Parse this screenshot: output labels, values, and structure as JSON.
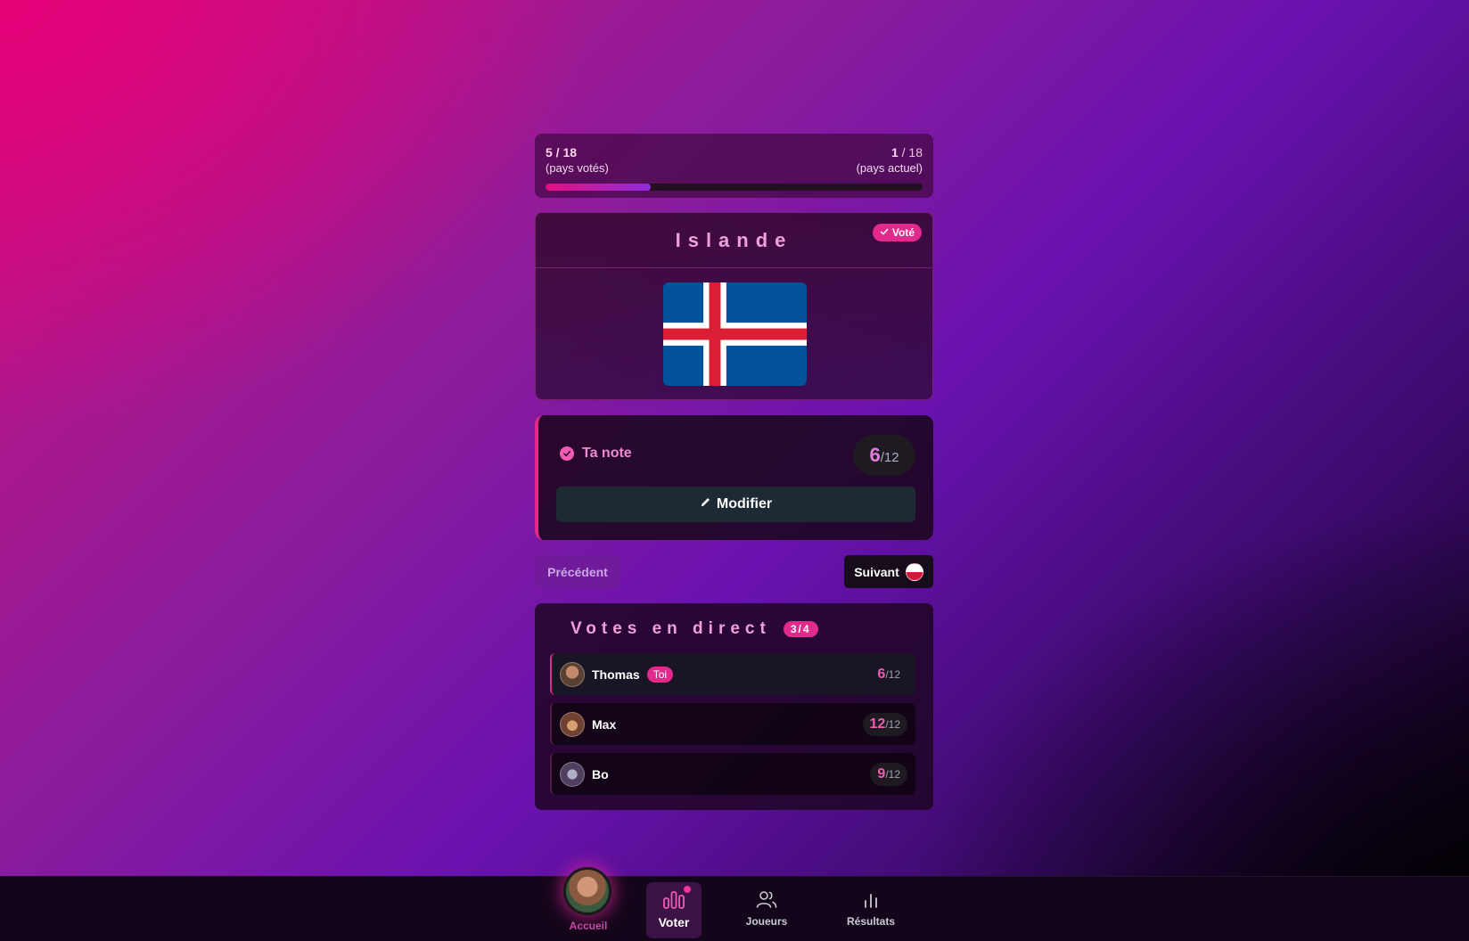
{
  "progress": {
    "voted_count": "5",
    "voted_total": " / 18",
    "voted_label": "(pays votés)",
    "current_count": "1",
    "current_total": " / 18",
    "current_label": "(pays actuel)",
    "fraction": 0.28
  },
  "country": {
    "name": "Islande",
    "badge": "Voté",
    "flag": "iceland-flag"
  },
  "rating": {
    "label": "Ta note",
    "score": "6",
    "denominator": "/12",
    "modify_label": "Modifier"
  },
  "navigation": {
    "previous_label": "Précédent",
    "next_label": "Suivant",
    "next_flag": "poland-flag"
  },
  "live_votes": {
    "title": "Votes en direct",
    "count": "3/4",
    "rows": [
      {
        "name": "Thomas",
        "badge": "Toi",
        "score": "6",
        "denominator": "/12"
      },
      {
        "name": "Max",
        "score": "12",
        "denominator": "/12"
      },
      {
        "name": "Bo",
        "score": "9",
        "denominator": "/12"
      }
    ]
  },
  "bottom_nav": {
    "home_label": "Accueil",
    "vote_label": "Voter",
    "players_label": "Joueurs",
    "results_label": "Résultats"
  },
  "colors": {
    "accent": "#e22a8c",
    "title": "#f0a0d8"
  }
}
